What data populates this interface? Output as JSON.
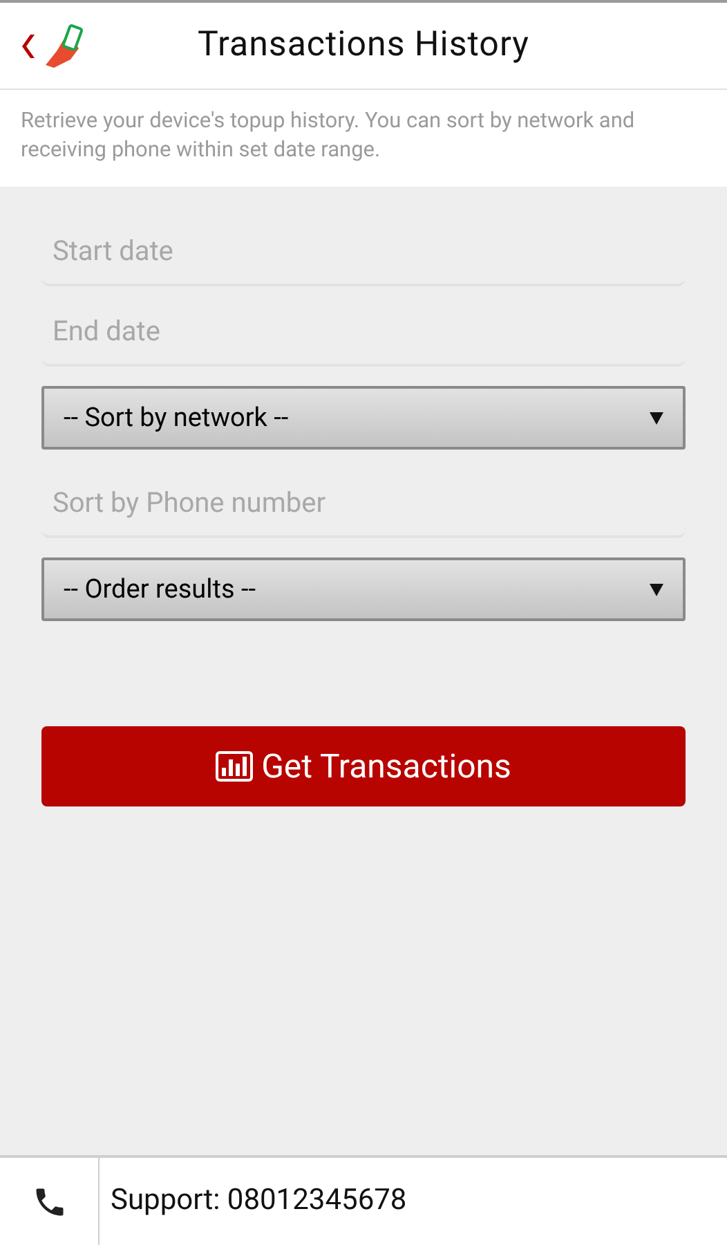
{
  "header": {
    "title": "Transactions History"
  },
  "description": "Retrieve your device's topup history. You can sort by network and receiving phone within set date range.",
  "form": {
    "fields": [
      {
        "kind": "input",
        "placeholder": "Start date"
      },
      {
        "kind": "input",
        "placeholder": "End date"
      },
      {
        "kind": "select",
        "value": "-- Sort by network --"
      },
      {
        "kind": "input",
        "placeholder": "Sort by Phone number"
      },
      {
        "kind": "select",
        "value": "-- Order results --"
      }
    ],
    "submit": "Get Transactions"
  },
  "footer": {
    "support": "Support: 08012345678"
  }
}
